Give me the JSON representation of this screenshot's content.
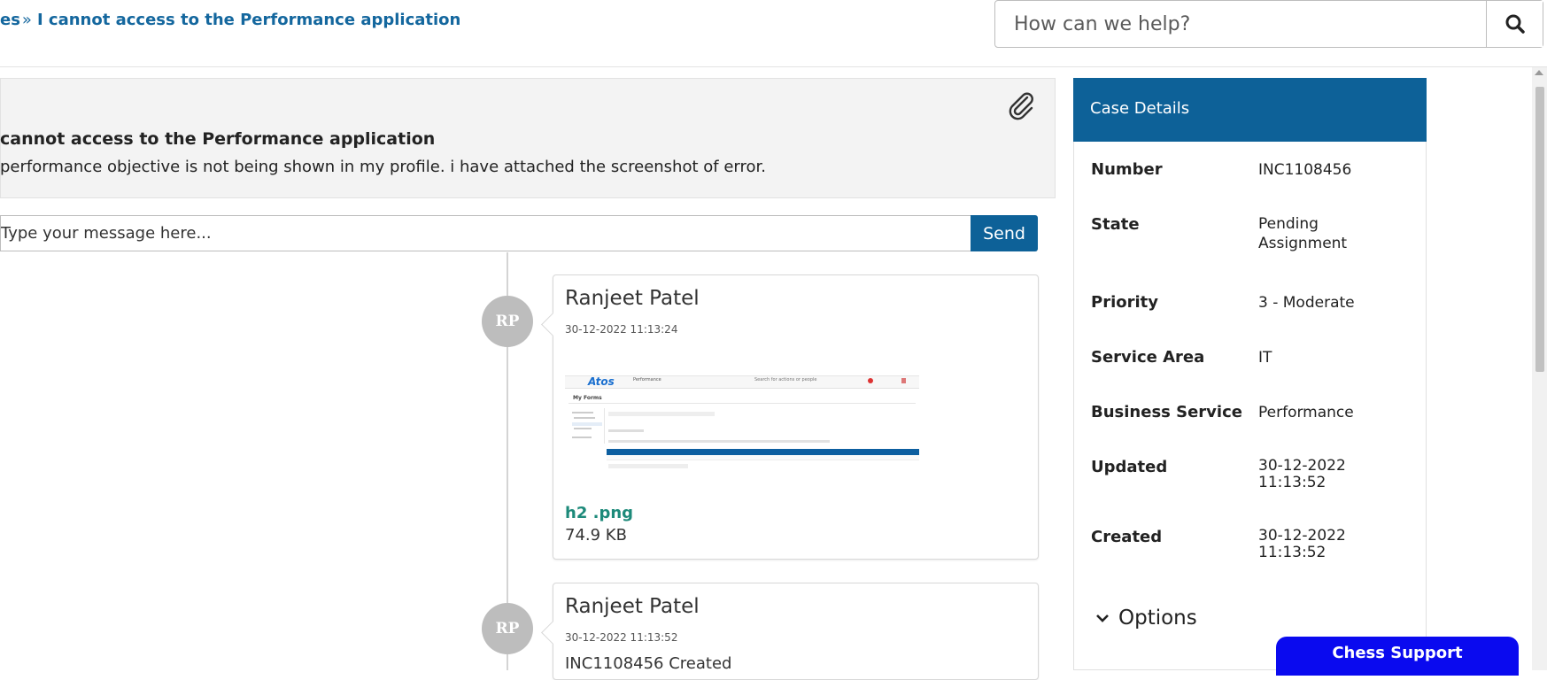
{
  "breadcrumb": {
    "prev_label": "es",
    "separator": "»",
    "current_label": "I cannot access to the Performance application"
  },
  "search": {
    "placeholder": "How can we help?",
    "icon": "search-icon"
  },
  "case": {
    "title": "cannot access to the Performance application",
    "description": "performance objective is not being shown in my profile. i have attached the screenshot of error.",
    "attachment_icon": "paperclip-icon"
  },
  "composer": {
    "placeholder": "Type your message here...",
    "send_label": "Send"
  },
  "timeline": [
    {
      "initials": "RP",
      "author": "Ranjeet Patel",
      "timestamp": "30-12-2022 11:13:24",
      "file_name": "h2 .png",
      "file_size": "74.9 KB"
    },
    {
      "initials": "RP",
      "author": "Ranjeet Patel",
      "timestamp": "30-12-2022 11:13:52",
      "text": "INC1108456 Created"
    }
  ],
  "thumbnail": {
    "logo": "Atos",
    "menu": "Performance",
    "search": "Search for actions or people",
    "heading": "My Forms"
  },
  "details": {
    "header": "Case Details",
    "rows": [
      {
        "label": "Number",
        "value": "INC1108456"
      },
      {
        "label": "State",
        "value": "Pending Assignment"
      },
      {
        "label": "Priority",
        "value": "3 - Moderate"
      },
      {
        "label": "Service Area",
        "value": "IT"
      },
      {
        "label": "Business Service",
        "value": "Performance"
      },
      {
        "label": "Updated",
        "value": "30-12-2022 11:13:52"
      },
      {
        "label": "Created",
        "value": "30-12-2022 11:13:52"
      }
    ],
    "options_label": "Options"
  },
  "support_button": "Chess Support",
  "colors": {
    "primary": "#0d6198",
    "link": "#14679e",
    "file_link": "#1d8a7a",
    "support": "#0a0aef"
  }
}
